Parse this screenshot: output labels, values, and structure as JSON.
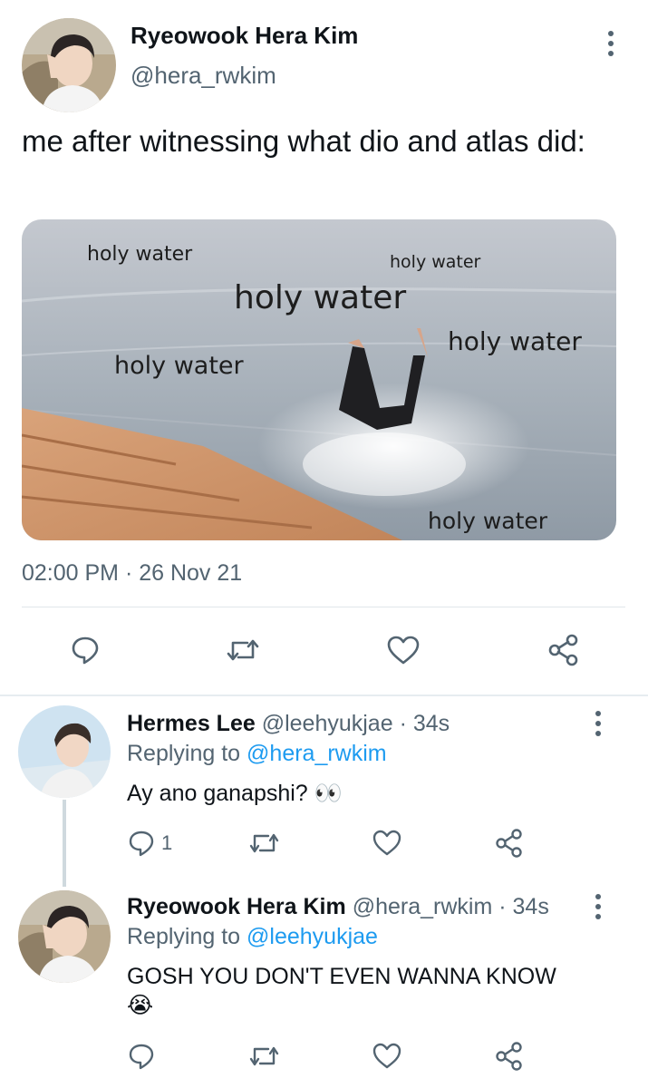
{
  "tweet": {
    "author_name": "Ryeowook Hera Kim",
    "author_handle": "@hera_rwkim",
    "text": "me after witnessing what dio and atlas did:",
    "media_labels": [
      "holy water",
      "holy water",
      "holy water",
      "holy water",
      "holy water",
      "holy water"
    ],
    "timestamp": "02:00 PM · 26 Nov 21"
  },
  "replies": [
    {
      "name": "Hermes Lee",
      "handle": "@leehyukjae",
      "time": "· 34s",
      "replying_prefix": "Replying to",
      "replying_to": "@hera_rwkim",
      "text": "Ay ano ganapshi? 👀",
      "reply_count": "1"
    },
    {
      "name": "Ryeowook Hera Kim",
      "handle": "@hera_rwkim",
      "time": "· 34s",
      "replying_prefix": "Replying to",
      "replying_to": "@leehyukjae",
      "text": "GOSH YOU DON'T EVEN WANNA KNOW",
      "emoji": "😭"
    }
  ],
  "icons": {
    "reply": "reply-icon",
    "retweet": "retweet-icon",
    "like": "heart-icon",
    "share": "share-icon",
    "more": "more-vertical-icon"
  },
  "colors": {
    "text": "#0f1419",
    "secondary": "#536471",
    "link": "#1d9bf0"
  }
}
